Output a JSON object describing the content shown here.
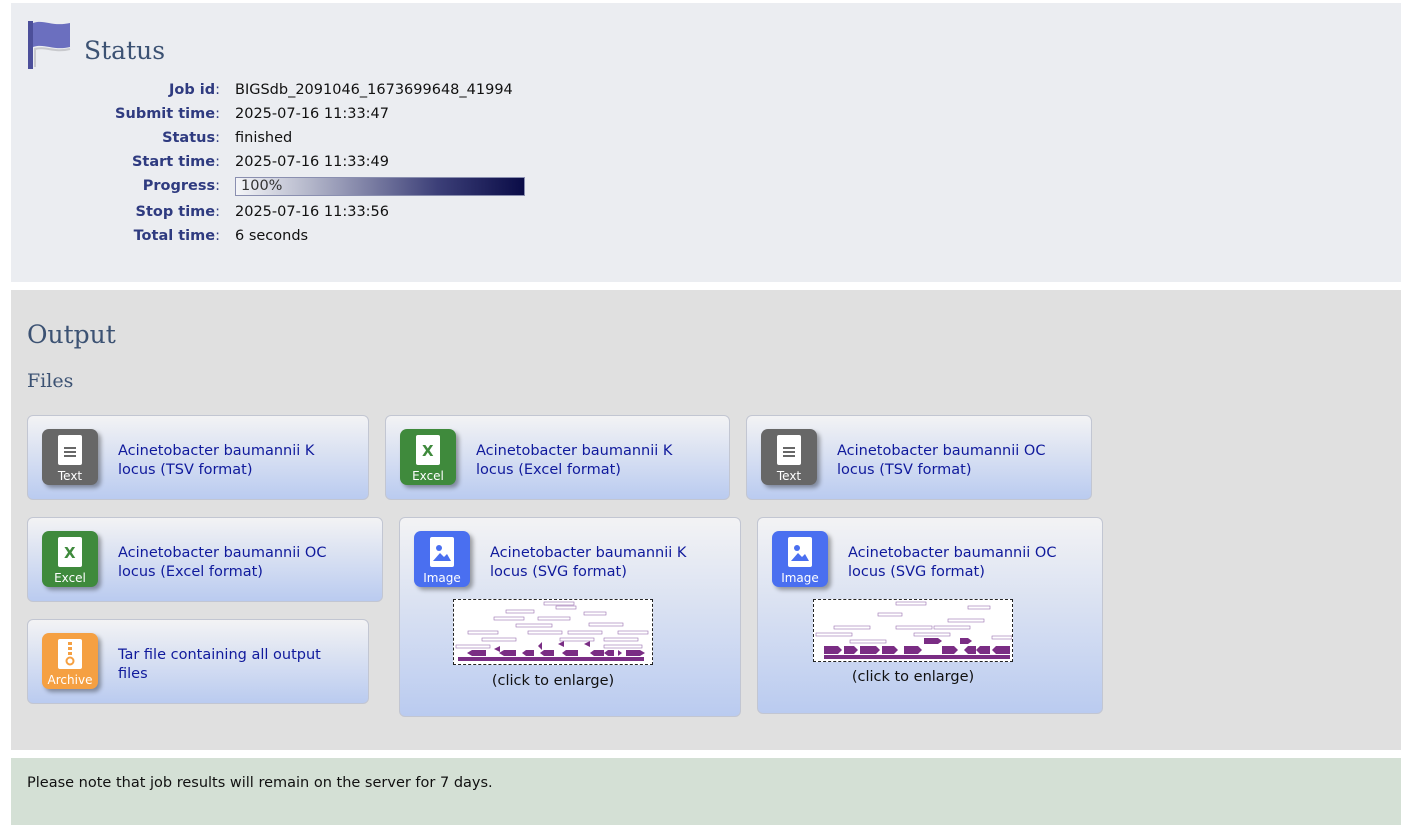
{
  "status": {
    "heading": "Status",
    "fields": [
      {
        "label": "Job id",
        "value": "BIGSdb_2091046_1673699648_41994"
      },
      {
        "label": "Submit time",
        "value": "2025-07-16 11:33:47"
      },
      {
        "label": "Status",
        "value": "finished"
      },
      {
        "label": "Start time",
        "value": "2025-07-16 11:33:49"
      },
      {
        "label": "Progress",
        "value": "100%",
        "progress": 1.0
      },
      {
        "label": "Stop time",
        "value": "2025-07-16 11:33:56"
      },
      {
        "label": "Total time",
        "value": "6 seconds"
      }
    ],
    "colon": ":"
  },
  "output": {
    "heading": "Output",
    "files_heading": "Files",
    "files": [
      {
        "type": "Text",
        "line1": "Acinetobacter baumannii K",
        "line2": "locus (TSV format)"
      },
      {
        "type": "Excel",
        "line1": "Acinetobacter baumannii K",
        "line2": "locus (Excel format)"
      },
      {
        "type": "Text",
        "line1": "Acinetobacter baumannii OC",
        "line2": "locus (TSV format)"
      },
      {
        "type": "Excel",
        "line1": "Acinetobacter baumannii OC",
        "line2": "locus (Excel format)"
      },
      {
        "type": "Image",
        "line1": "Acinetobacter baumannii K",
        "line2": "locus (SVG format)",
        "caption": "(click to enlarge)"
      },
      {
        "type": "Image",
        "line1": "Acinetobacter baumannii OC",
        "line2": "locus (SVG format)",
        "caption": "(click to enlarge)"
      },
      {
        "type": "Archive",
        "line1": "Tar file containing all output",
        "line2": "files"
      }
    ]
  },
  "note": "Please note that job results will remain on the server for 7 days.",
  "colors": {
    "text_icon": "#676767",
    "excel_icon": "#3f8a3c",
    "image_icon": "#4a6ff0",
    "archive_icon": "#f5a042",
    "link": "#101a9c",
    "label": "#2f3b80"
  }
}
